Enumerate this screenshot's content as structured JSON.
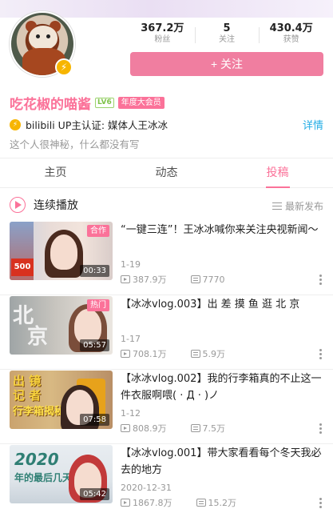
{
  "profile": {
    "stats": [
      {
        "value": "367.2万",
        "label": "粉丝"
      },
      {
        "value": "5",
        "label": "关注"
      },
      {
        "value": "430.4万",
        "label": "获赞"
      }
    ],
    "follow_label": "+ 关注",
    "name": "吃花椒的喵酱",
    "level": "LV6",
    "vip": "年度大会员",
    "up_cert": "bilibili  UP主认证: 媒体人王冰冰",
    "details_label": "详情",
    "sign": "这个人很神秘，什么都没有写"
  },
  "tabs": [
    {
      "label": "主页",
      "active": false
    },
    {
      "label": "动态",
      "active": false
    },
    {
      "label": "投稿",
      "active": true
    }
  ],
  "list_header": {
    "autoplay_label": "连续播放",
    "sort_label": "最新发布"
  },
  "videos": [
    {
      "title": "“一键三连”！王冰冰喊你来关注央视新闻～",
      "date": "1-19",
      "views": "387.9万",
      "danmaku": "7770",
      "duration": "00:33",
      "tag": "合作"
    },
    {
      "title": "【冰冰vlog.003】出 差 摸 鱼 逛 北 京",
      "date": "1-17",
      "views": "708.1万",
      "danmaku": "5.9万",
      "duration": "05:57",
      "tag": "热门"
    },
    {
      "title": "【冰冰vlog.002】我的行李箱真的不止这一件衣服啊喂( · Д · )ノ",
      "date": "1-12",
      "views": "808.9万",
      "danmaku": "7.5万",
      "duration": "07:58",
      "tag": ""
    },
    {
      "title": "【冰冰vlog.001】带大家看看每个冬天我必去的地方",
      "date": "2020-12-31",
      "views": "1867.8万",
      "danmaku": "15.2万",
      "duration": "05:42",
      "tag": ""
    }
  ]
}
